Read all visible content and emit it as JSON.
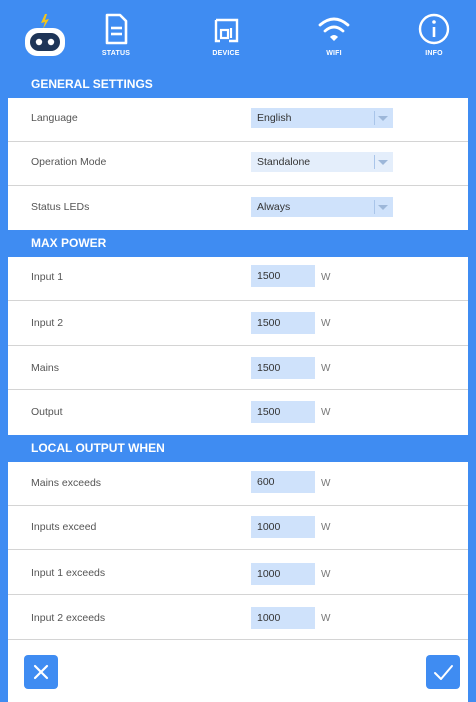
{
  "nav": {
    "items": [
      {
        "label": "STATUS",
        "icon": "document-icon"
      },
      {
        "label": "DEVICE",
        "icon": "device-icon"
      },
      {
        "label": "WIFI",
        "icon": "wifi-icon"
      },
      {
        "label": "INFO",
        "icon": "info-icon"
      }
    ]
  },
  "general": {
    "title": "GENERAL SETTINGS",
    "language": {
      "label": "Language",
      "value": "English"
    },
    "operation_mode": {
      "label": "Operation Mode",
      "value": "Standalone"
    },
    "status_leds": {
      "label": "Status LEDs",
      "value": "Always"
    }
  },
  "max_power": {
    "title": "MAX POWER",
    "input1": {
      "label": "Input 1",
      "value": "1500",
      "unit": "W"
    },
    "input2": {
      "label": "Input 2",
      "value": "1500",
      "unit": "W"
    },
    "mains": {
      "label": "Mains",
      "value": "1500",
      "unit": "W"
    },
    "output": {
      "label": "Output",
      "value": "1500",
      "unit": "W"
    }
  },
  "local_output": {
    "title": "LOCAL OUTPUT WHEN",
    "mains_exceeds": {
      "label": "Mains exceeds",
      "value": "600",
      "unit": "W"
    },
    "inputs_exceed": {
      "label": "Inputs exceed",
      "value": "1000",
      "unit": "W"
    },
    "input1_exceeds": {
      "label": "Input 1 exceeds",
      "value": "1000",
      "unit": "W"
    },
    "input2_exceeds": {
      "label": "Input 2 exceeds",
      "value": "1000",
      "unit": "W"
    }
  },
  "actions": {
    "cancel_icon": "close-icon",
    "confirm_icon": "check-icon"
  },
  "colors": {
    "accent": "#3f8cf2",
    "field": "#cfe2fb",
    "divider": "#d4d4d4"
  }
}
